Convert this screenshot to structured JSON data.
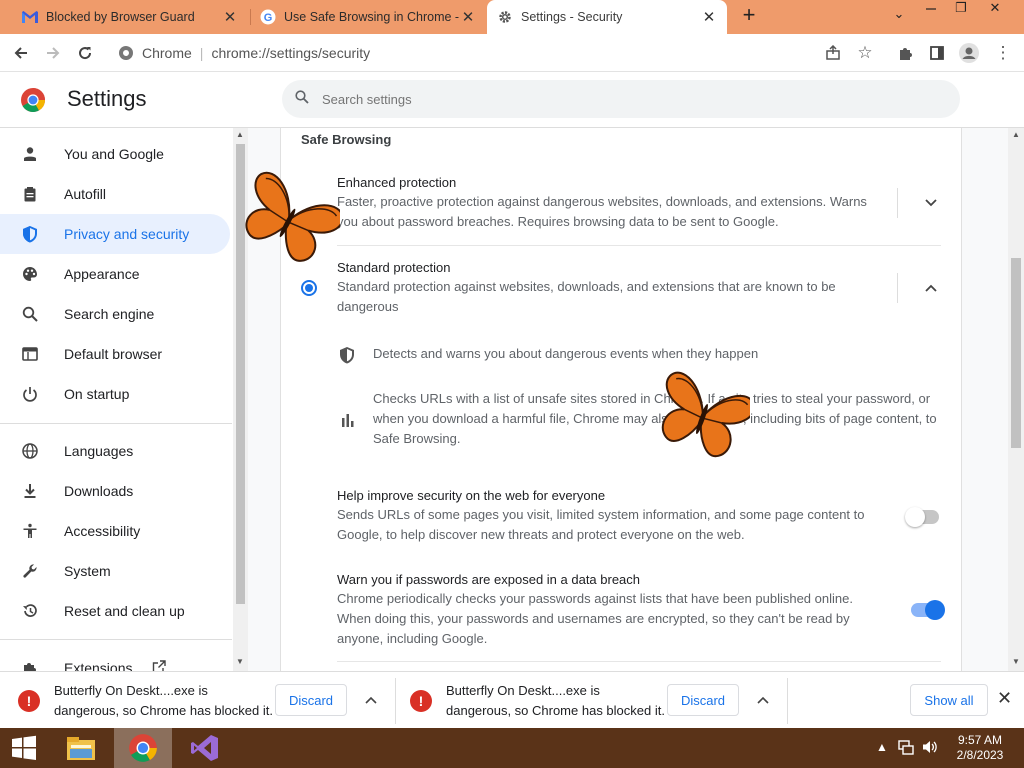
{
  "tabs": [
    {
      "title": "Blocked by Browser Guard",
      "close": "✕"
    },
    {
      "title": "Use Safe Browsing in Chrome - C",
      "close": "✕"
    },
    {
      "title": "Settings - Security",
      "close": "✕"
    }
  ],
  "new_tab": "+",
  "window_controls": {
    "minimize": "⌄",
    "restore": "❐",
    "close": "✕"
  },
  "omnibox": {
    "site": "Chrome",
    "separator": "|",
    "url": "chrome://settings/security"
  },
  "settings": {
    "title": "Settings",
    "search_placeholder": "Search settings"
  },
  "sidebar": {
    "items": [
      {
        "label": "You and Google",
        "icon": "person-icon"
      },
      {
        "label": "Autofill",
        "icon": "clipboard-icon"
      },
      {
        "label": "Privacy and security",
        "icon": "shield-icon"
      },
      {
        "label": "Appearance",
        "icon": "palette-icon"
      },
      {
        "label": "Search engine",
        "icon": "search-icon"
      },
      {
        "label": "Default browser",
        "icon": "browser-icon"
      },
      {
        "label": "On startup",
        "icon": "power-icon"
      },
      {
        "label": "Languages",
        "icon": "globe-icon"
      },
      {
        "label": "Downloads",
        "icon": "download-icon"
      },
      {
        "label": "Accessibility",
        "icon": "accessibility-icon"
      },
      {
        "label": "System",
        "icon": "wrench-icon"
      },
      {
        "label": "Reset and clean up",
        "icon": "history-icon"
      },
      {
        "label": "Extensions",
        "icon": "puzzle-icon"
      }
    ],
    "selected": "Privacy and security"
  },
  "safe_browsing": {
    "section_title": "Safe Browsing",
    "enhanced": {
      "title": "Enhanced protection",
      "desc1": "Faster, proactive protection against dangerous websites, downloads, and extensions. Warns",
      "desc2": "you about password breaches. Requires browsing data to be sent to Google."
    },
    "standard": {
      "title": "Standard protection",
      "desc1": "Standard protection against websites, downloads, and extensions that are known to be",
      "desc2": "dangerous",
      "selected": true
    },
    "detail1": "Detects and warns you about dangerous events when they happen",
    "detail2_l1": "Checks URLs with a list of unsafe sites stored in Chrome. If a site tries to steal your password, or",
    "detail2_l2": "when you download a harmful file, Chrome may also send URLs, including bits of page content, to",
    "detail2_l3": "Safe Browsing.",
    "help_improve": {
      "title": "Help improve security on the web for everyone",
      "desc1": "Sends URLs of some pages you visit, limited system information, and some page content to",
      "desc2": "Google, to help discover new threats and protect everyone on the web.",
      "enabled": false
    },
    "password_warn": {
      "title": "Warn you if passwords are exposed in a data breach",
      "desc1": "Chrome periodically checks your passwords against lists that have been published online.",
      "desc2": "When doing this, your passwords and usernames are encrypted, so they can't be read by",
      "desc3": "anyone, including Google.",
      "enabled": true
    }
  },
  "downloads": [
    {
      "line1": "Butterfly On Deskt....exe is",
      "line2": "dangerous, so Chrome has blocked it.",
      "discard": "Discard"
    },
    {
      "line1": "Butterfly On Deskt....exe is",
      "line2": "dangerous, so Chrome has blocked it.",
      "discard": "Discard"
    }
  ],
  "show_all": "Show all",
  "clock": {
    "time": "9:57 AM",
    "date": "2/8/2023"
  },
  "colors": {
    "accent": "#1a73e8",
    "tabstrip": "#ef9b6b",
    "taskbar": "#5a3318",
    "danger": "#d93025"
  }
}
